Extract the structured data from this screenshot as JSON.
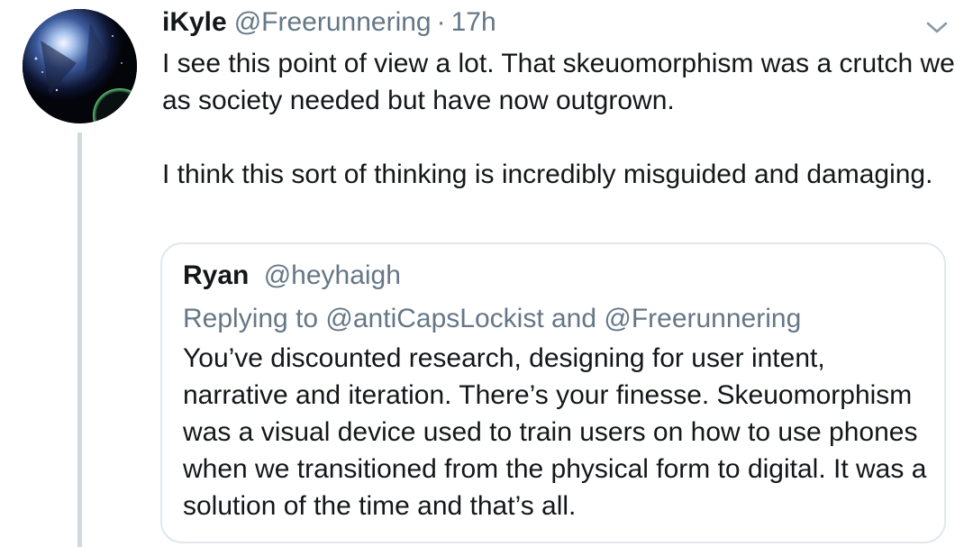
{
  "tweet": {
    "author_name": "iKyle",
    "author_handle": "@Freerunnering",
    "separator": "·",
    "time": "17h",
    "paragraph_1": "I see this point of view a lot. That skeuomorphism was a crutch we as society needed but have now outgrown.",
    "paragraph_2": "I think this sort of thinking is incredibly misguided and damaging.",
    "menu_icon": "chevron-down-icon",
    "thread_line_color": "#cfd9de"
  },
  "quoted_tweet": {
    "author_name": "Ryan",
    "author_handle": "@heyhaigh",
    "replying_to": "Replying to @antiCapsLockist and @Freerunnering",
    "text": "You’ve discounted research, designing for user intent, narrative and iteration. There’s your finesse. Skeuomorphism was a visual device used to train users on how to use phones when we transitioned from the physical form to digital. It was a solution of the time and that’s all.",
    "border_color": "#e1e8ed"
  },
  "colors": {
    "primary_text": "#14171a",
    "secondary_text": "#657786"
  }
}
